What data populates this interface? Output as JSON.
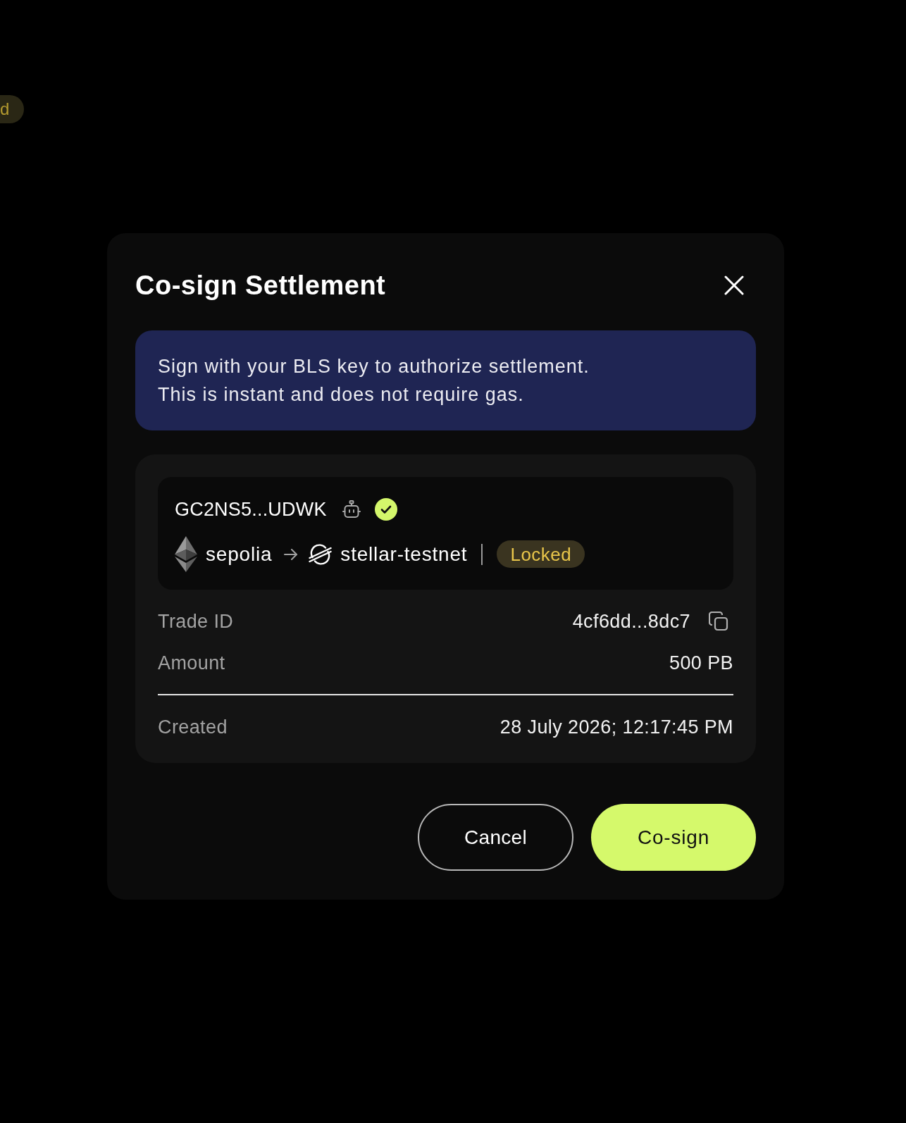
{
  "background": {
    "badge": {
      "text": "d"
    }
  },
  "dialog": {
    "title": "Co-sign Settlement",
    "notice": [
      "Sign with your BLS key to authorize settlement.",
      "This is instant and does not require gas."
    ],
    "account": {
      "address": "GC2NS5...UDWK",
      "verified": true
    },
    "route": [
      {
        "network": "sepolia",
        "kind": "ethereum"
      },
      {
        "network": "stellar-testnet",
        "kind": "stellar"
      }
    ],
    "status": {
      "label": "Locked"
    },
    "details": [
      {
        "label": "Trade ID",
        "value": "4cf6dd...8dc7",
        "copyable": true
      },
      {
        "label": "Amount",
        "value": "500 PB",
        "copyable": false
      }
    ],
    "created": {
      "label": "Created",
      "value": "28 July 2026; 12:17:45 PM"
    },
    "buttons": [
      {
        "label": "Cancel",
        "kind": "secondary"
      },
      {
        "label": "Co-sign",
        "kind": "primary"
      }
    ]
  }
}
